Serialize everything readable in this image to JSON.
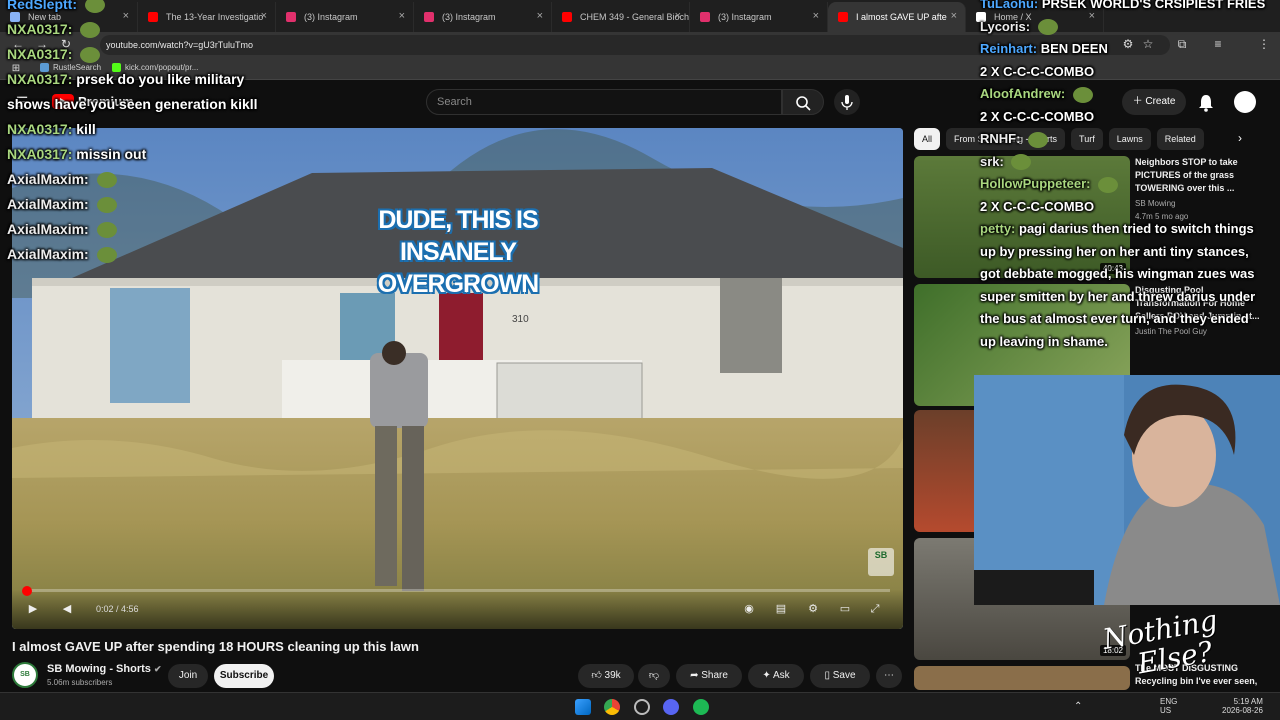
{
  "tabs": [
    {
      "label": "New tab",
      "color": "#8ab4f8"
    },
    {
      "label": "The 13-Year Investigatio",
      "color": "#ff0000"
    },
    {
      "label": "(3) Instagram",
      "color": "#e1306c"
    },
    {
      "label": "(3) Instagram",
      "color": "#e1306c"
    },
    {
      "label": "CHEM 349 - General Bioch",
      "color": "#ff0000"
    },
    {
      "label": "(3) Instagram",
      "color": "#e1306c"
    },
    {
      "label": "I almost GAVE UP afte",
      "color": "#ff0000"
    },
    {
      "label": "Home / X",
      "color": "#ffffff"
    }
  ],
  "address": {
    "url": "youtube.com/watch?v=gU3rTuluTmo"
  },
  "bookmarks": [
    {
      "label": "RustleSearch"
    },
    {
      "label": "kick.com/popout/pr..."
    }
  ],
  "youtube_header": {
    "brand": "Premium",
    "search_placeholder": "Search",
    "create_label": "Create"
  },
  "video": {
    "caption_text": "DUDE, THIS IS INSANELY OVERGROWN",
    "house_number": "310",
    "watermark": "SB",
    "timecode": "0:02 / 4:56",
    "progress": 0.007
  },
  "meta": {
    "title": "I almost GAVE UP after spending 18 HOURS cleaning up this lawn",
    "channel_name": "SB Mowing - Shorts",
    "subscribers": "5.06m subscribers",
    "avatar_text": "SB",
    "join_label": "Join",
    "subscribe_label": "Subscribe",
    "like_count": "39k",
    "share_label": "Share",
    "ask_label": "Ask",
    "save_label": "Save"
  },
  "chips": [
    "All",
    "From SB Mowing - Shorts",
    "Turf",
    "Lawns",
    "Related"
  ],
  "recommendations": [
    {
      "title": "Neighbors STOP to take PICTURES of the grass TOWERING over this ...",
      "channel": "SB Mowing",
      "meta": "4.7m  5 mo ago",
      "duration": "40:43"
    },
    {
      "title": "Disgusting Pool Transformation For Home Sellers POV and Jump in at...",
      "channel": "Justin The Pool Guy",
      "meta": "",
      "duration": ""
    },
    {
      "title": "The MOST DISGUSTING Recycling bin I've ever seen, we",
      "channel": "",
      "meta": "",
      "duration": "18:02"
    }
  ],
  "chat_left": [
    {
      "name": "RedSleptt:",
      "text": "",
      "color": "blue"
    },
    {
      "name": "NXA0317:",
      "text": "",
      "color": "green"
    },
    {
      "name": "NXA0317:",
      "text": "",
      "color": "green"
    },
    {
      "name": "NXA0317:",
      "text": "prsek do you like military",
      "color": "green"
    },
    {
      "name": "",
      "text": "shows have you seen generation kikll",
      "color": "white"
    },
    {
      "name": "NXA0317:",
      "text": "kill",
      "color": "green"
    },
    {
      "name": "NXA0317:",
      "text": "missin out",
      "color": "green"
    },
    {
      "name": "AxialMaxim:",
      "text": "",
      "color": "white"
    },
    {
      "name": "AxialMaxim:",
      "text": "",
      "color": "white"
    },
    {
      "name": "AxialMaxim:",
      "text": "",
      "color": "white"
    },
    {
      "name": "AxialMaxim:",
      "text": "",
      "color": "white"
    }
  ],
  "chat_right": [
    {
      "name": "TuLaohu:",
      "text": "PRSEK WORLD'S CRSIPIEST FRIES",
      "color": "blue"
    },
    {
      "name": "Lycoris:",
      "text": "",
      "color": "white"
    },
    {
      "name": "Reinhart:",
      "text": "BEN DEEN",
      "color": "blue"
    },
    {
      "name": "",
      "text": "2 X C-C-C-COMBO",
      "color": "white"
    },
    {
      "name": "AloofAndrew:",
      "text": "",
      "color": "green"
    },
    {
      "name": "",
      "text": "2 X C-C-C-COMBO",
      "color": "white"
    },
    {
      "name": "RNHF:",
      "text": "",
      "color": "white"
    },
    {
      "name": "srk:",
      "text": "",
      "color": "white"
    },
    {
      "name": "HollowPuppeteer:",
      "text": "",
      "color": "green"
    },
    {
      "name": "",
      "text": "2 X C-C-C-COMBO",
      "color": "white"
    },
    {
      "name": "petty:",
      "text": "pagi darius then tried to switch things",
      "color": "green"
    },
    {
      "name": "",
      "text": "up by pressing her on her anti tiny stances,",
      "color": "white"
    },
    {
      "name": "",
      "text": "got debbate mogged, his wingman zues was",
      "color": "white"
    },
    {
      "name": "",
      "text": "super smitten by her and threw darius under",
      "color": "white"
    },
    {
      "name": "",
      "text": "the bus at almost ever turn, and they ended",
      "color": "white"
    },
    {
      "name": "",
      "text": "up leaving in shame.",
      "color": "white"
    }
  ],
  "stream_logo": {
    "line1": "Nothing",
    "line2": "Else?"
  },
  "taskbar": {
    "lang": "ENG",
    "region": "US",
    "time": "5:19 AM",
    "date": "2026-08-26"
  },
  "colors": {
    "accent": "#ff0000",
    "bg": "#0f0f0f",
    "chip_bg": "#272727"
  }
}
